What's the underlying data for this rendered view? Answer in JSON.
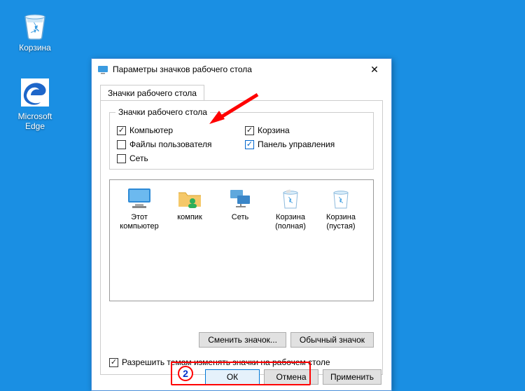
{
  "desktop": {
    "icons": [
      {
        "name": "recycle-bin",
        "label": "Корзина"
      },
      {
        "name": "edge",
        "label": "Microsoft Edge"
      }
    ]
  },
  "dialog": {
    "title": "Параметры значков рабочего стола",
    "tab_label": "Значки рабочего стола",
    "group_title": "Значки рабочего стола",
    "checks": [
      {
        "label": "Компьютер",
        "checked": true
      },
      {
        "label": "Корзина",
        "checked": true
      },
      {
        "label": "Файлы пользователя",
        "checked": false
      },
      {
        "label": "Панель управления",
        "checked": true,
        "blue": true
      },
      {
        "label": "Сеть",
        "checked": false
      }
    ],
    "icons": [
      {
        "label": "Этот компьютер"
      },
      {
        "label": "компик"
      },
      {
        "label": "Сеть"
      },
      {
        "label": "Корзина (полная)"
      },
      {
        "label": "Корзина (пустая)"
      }
    ],
    "change_icon": "Сменить значок...",
    "restore_default": "Обычный значок",
    "allow_themes": "Разрешить темам изменять значки на рабочем столе",
    "buttons": {
      "ok": "ОК",
      "cancel": "Отмена",
      "apply": "Применить"
    }
  },
  "annotation": {
    "step": "2"
  }
}
